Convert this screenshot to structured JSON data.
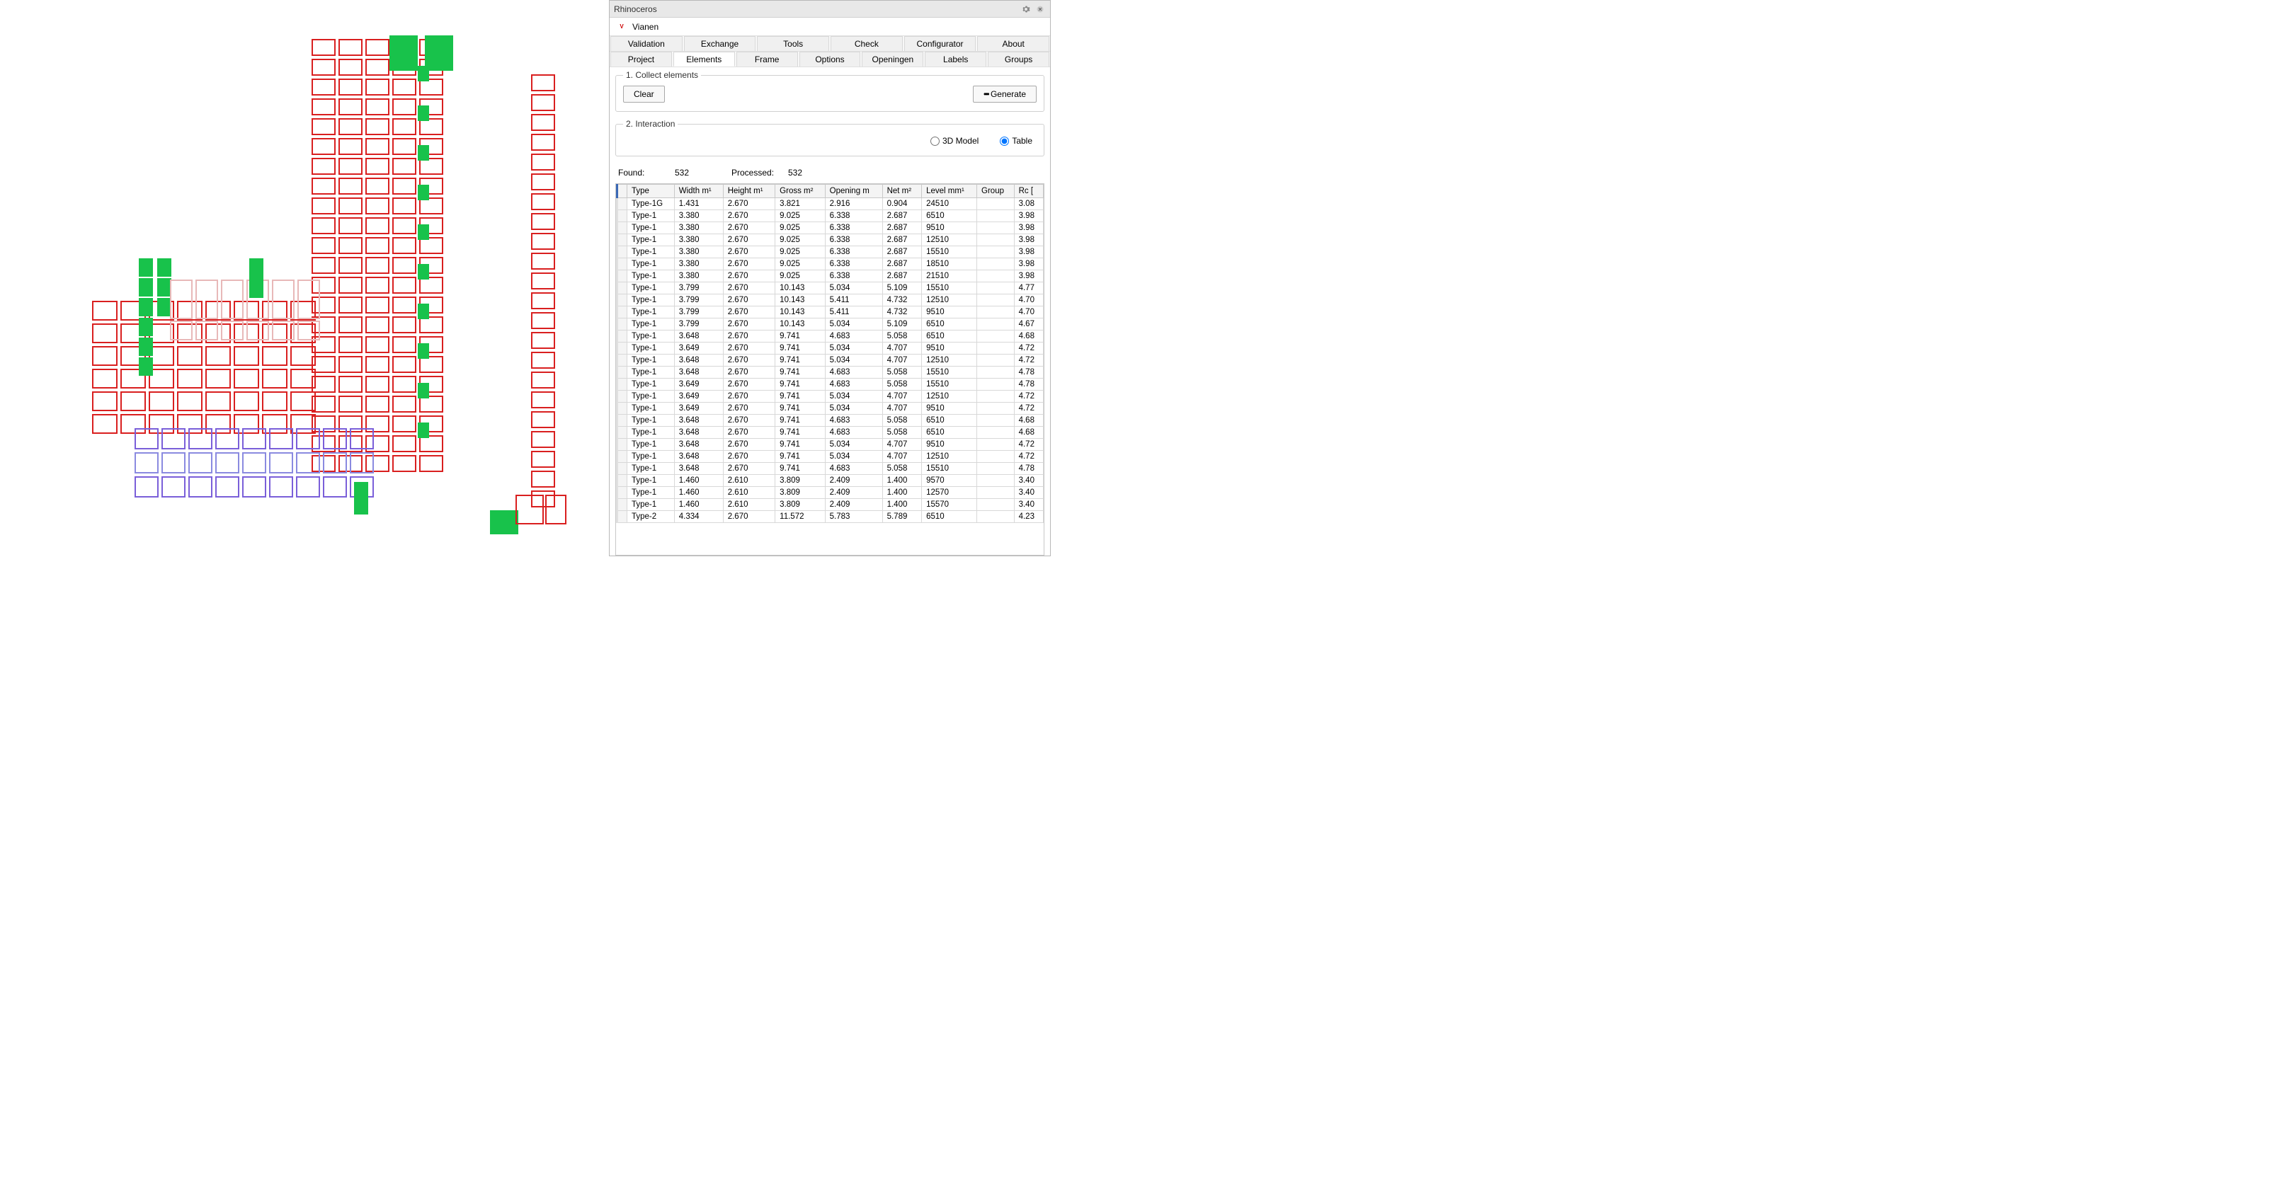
{
  "window": {
    "title": "Rhinoceros",
    "project": "Vianen"
  },
  "tabs_row1": [
    "Validation",
    "Exchange",
    "Tools",
    "Check",
    "Configurator",
    "About"
  ],
  "tabs_row2": [
    "Project",
    "Elements",
    "Frame",
    "Options",
    "Openingen",
    "Labels",
    "Groups"
  ],
  "tabs_row2_active": "Elements",
  "section1": {
    "legend": "1. Collect elements",
    "clear": "Clear",
    "generate": "Generate"
  },
  "section2": {
    "legend": "2. Interaction",
    "radio_model": "3D Model",
    "radio_table": "Table"
  },
  "stats": {
    "found_label": "Found:",
    "found_value": "532",
    "processed_label": "Processed:",
    "processed_value": "532"
  },
  "table": {
    "headers": [
      "Type",
      "Width m¹",
      "Height m¹",
      "Gross m²",
      "Opening m",
      "Net m²",
      "Level mm¹",
      "Group",
      "Rc ["
    ],
    "rows": [
      [
        "Type-1G",
        "1.431",
        "2.670",
        "3.821",
        "2.916",
        "0.904",
        "24510",
        "",
        "3.08"
      ],
      [
        "Type-1",
        "3.380",
        "2.670",
        "9.025",
        "6.338",
        "2.687",
        "6510",
        "",
        "3.98"
      ],
      [
        "Type-1",
        "3.380",
        "2.670",
        "9.025",
        "6.338",
        "2.687",
        "9510",
        "",
        "3.98"
      ],
      [
        "Type-1",
        "3.380",
        "2.670",
        "9.025",
        "6.338",
        "2.687",
        "12510",
        "",
        "3.98"
      ],
      [
        "Type-1",
        "3.380",
        "2.670",
        "9.025",
        "6.338",
        "2.687",
        "15510",
        "",
        "3.98"
      ],
      [
        "Type-1",
        "3.380",
        "2.670",
        "9.025",
        "6.338",
        "2.687",
        "18510",
        "",
        "3.98"
      ],
      [
        "Type-1",
        "3.380",
        "2.670",
        "9.025",
        "6.338",
        "2.687",
        "21510",
        "",
        "3.98"
      ],
      [
        "Type-1",
        "3.799",
        "2.670",
        "10.143",
        "5.034",
        "5.109",
        "15510",
        "",
        "4.77"
      ],
      [
        "Type-1",
        "3.799",
        "2.670",
        "10.143",
        "5.411",
        "4.732",
        "12510",
        "",
        "4.70"
      ],
      [
        "Type-1",
        "3.799",
        "2.670",
        "10.143",
        "5.411",
        "4.732",
        "9510",
        "",
        "4.70"
      ],
      [
        "Type-1",
        "3.799",
        "2.670",
        "10.143",
        "5.034",
        "5.109",
        "6510",
        "",
        "4.67"
      ],
      [
        "Type-1",
        "3.648",
        "2.670",
        "9.741",
        "4.683",
        "5.058",
        "6510",
        "",
        "4.68"
      ],
      [
        "Type-1",
        "3.649",
        "2.670",
        "9.741",
        "5.034",
        "4.707",
        "9510",
        "",
        "4.72"
      ],
      [
        "Type-1",
        "3.648",
        "2.670",
        "9.741",
        "5.034",
        "4.707",
        "12510",
        "",
        "4.72"
      ],
      [
        "Type-1",
        "3.648",
        "2.670",
        "9.741",
        "4.683",
        "5.058",
        "15510",
        "",
        "4.78"
      ],
      [
        "Type-1",
        "3.649",
        "2.670",
        "9.741",
        "4.683",
        "5.058",
        "15510",
        "",
        "4.78"
      ],
      [
        "Type-1",
        "3.649",
        "2.670",
        "9.741",
        "5.034",
        "4.707",
        "12510",
        "",
        "4.72"
      ],
      [
        "Type-1",
        "3.649",
        "2.670",
        "9.741",
        "5.034",
        "4.707",
        "9510",
        "",
        "4.72"
      ],
      [
        "Type-1",
        "3.648",
        "2.670",
        "9.741",
        "4.683",
        "5.058",
        "6510",
        "",
        "4.68"
      ],
      [
        "Type-1",
        "3.648",
        "2.670",
        "9.741",
        "4.683",
        "5.058",
        "6510",
        "",
        "4.68"
      ],
      [
        "Type-1",
        "3.648",
        "2.670",
        "9.741",
        "5.034",
        "4.707",
        "9510",
        "",
        "4.72"
      ],
      [
        "Type-1",
        "3.648",
        "2.670",
        "9.741",
        "5.034",
        "4.707",
        "12510",
        "",
        "4.72"
      ],
      [
        "Type-1",
        "3.648",
        "2.670",
        "9.741",
        "4.683",
        "5.058",
        "15510",
        "",
        "4.78"
      ],
      [
        "Type-1",
        "1.460",
        "2.610",
        "3.809",
        "2.409",
        "1.400",
        "9570",
        "",
        "3.40"
      ],
      [
        "Type-1",
        "1.460",
        "2.610",
        "3.809",
        "2.409",
        "1.400",
        "12570",
        "",
        "3.40"
      ],
      [
        "Type-1",
        "1.460",
        "2.610",
        "3.809",
        "2.409",
        "1.400",
        "15570",
        "",
        "3.40"
      ],
      [
        "Type-2",
        "4.334",
        "2.670",
        "11.572",
        "5.783",
        "5.789",
        "6510",
        "",
        "4.23"
      ]
    ]
  },
  "colors": {
    "red": "#d91f1f",
    "green": "#18c24b",
    "blue": "#8a8ae0",
    "purple": "#7a5fd9",
    "pink": "#e8b8b8",
    "yellow": "#e0c040"
  }
}
